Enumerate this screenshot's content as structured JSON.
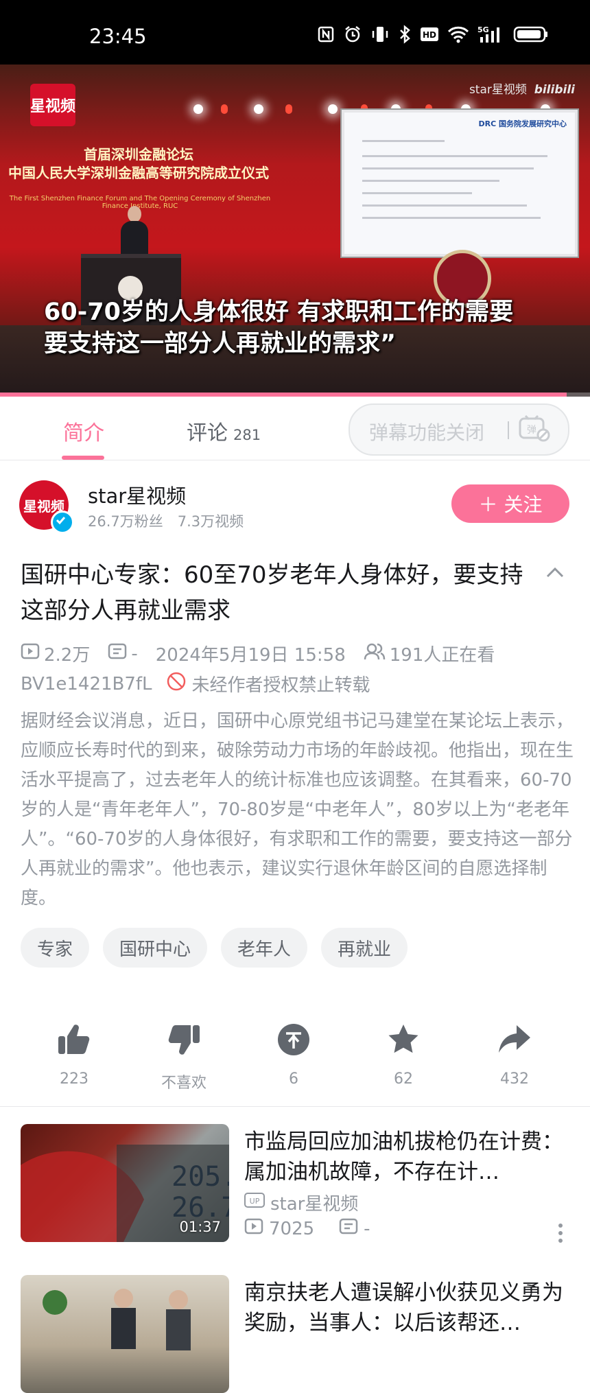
{
  "status_bar": {
    "time": "23:45",
    "icons": [
      "nfc-icon",
      "alarm-icon",
      "vibrate-icon",
      "bluetooth-icon",
      "hd-icon",
      "wifi-icon",
      "5g-signal-icon",
      "battery-icon"
    ]
  },
  "video": {
    "channel_logo": "星视频",
    "watermark": "star星视频",
    "platform_logo": "bilibili",
    "forum_title_line1": "首届深圳金融论坛",
    "forum_title_line2": "中国人民大学深圳金融高等研究院成立仪式",
    "forum_sub": "The First Shenzhen Finance Forum and The Opening Ceremony of Shenzhen Finance Institute, RUC",
    "screen_org": "DRC 国务院发展研究中心",
    "subtitle_line1": "60-70岁的人身体很好 有求职和工作的需要",
    "subtitle_line2": "要支持这一部分人再就业的需求”",
    "progress": 0.96
  },
  "tabs": {
    "intro_label": "简介",
    "comments_label": "评论",
    "comments_count": "281",
    "danmaku_label": "弹幕功能关闭"
  },
  "uploader": {
    "avatar_text": "星视频",
    "name": "star星视频",
    "stats": "26.7万粉丝　7.3万视频",
    "follow_label": "＋ 关注"
  },
  "video_info": {
    "title": "国研中心专家：60至70岁老年人身体好，要支持这部分人再就业需求",
    "plays": "2.2万",
    "danmaku": "-",
    "date": "2024年5月19日 15:58",
    "watching": "191人正在看",
    "bvid": "BV1e1421B7fL",
    "copyright": "未经作者授权禁止转载",
    "description": "据财经会议消息，近日，国研中心原党组书记马建堂在某论坛上表示，应顺应长寿时代的到来，破除劳动力市场的年龄歧视。他指出，现在生活水平提高了，过去老年人的统计标准也应该调整。在其看来，60-70岁的人是“青年老年人”，70-80岁是“中老年人”，80岁以上为“老老年人”。“60-70岁的人身体很好，有求职和工作的需要，要支持这一部分人再就业的需求”。他也表示，建议实行退休年龄区间的自愿选择制度。",
    "tags": [
      "专家",
      "国研中心",
      "老年人",
      "再就业"
    ]
  },
  "actions": {
    "like": "223",
    "dislike": "不喜欢",
    "coin": "6",
    "favorite": "62",
    "share": "432"
  },
  "recommendations": [
    {
      "title": "市监局回应加油机拔枪仍在计费：属加油机故障，不存在计…",
      "duration": "01:37",
      "up": "star星视频",
      "plays": "7025",
      "danmaku": "-"
    },
    {
      "title": "南京扶老人遭误解小伙获见义勇为奖励，当事人：以后该帮还…"
    }
  ],
  "colors": {
    "accent": "#fb7299",
    "text_primary": "#18191c",
    "text_secondary": "#9499a0"
  }
}
